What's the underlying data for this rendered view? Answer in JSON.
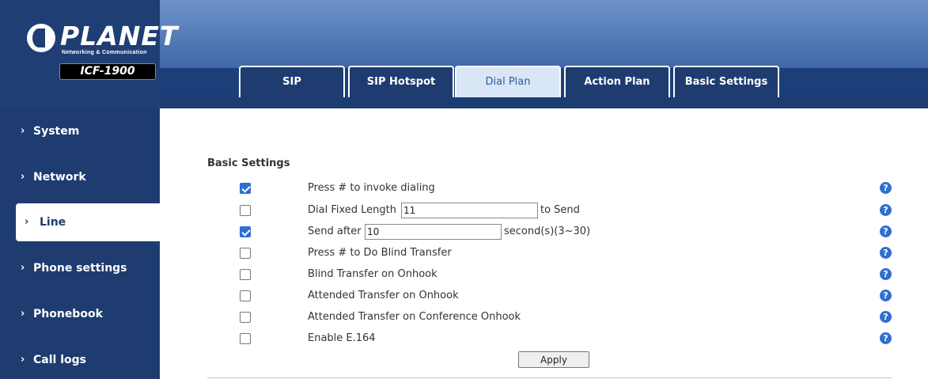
{
  "brand": {
    "logo_text": "PLANET",
    "logo_sub": "Networking & Communication",
    "model": "ICF-1900"
  },
  "tabs": [
    {
      "label": "SIP"
    },
    {
      "label": "SIP Hotspot"
    },
    {
      "label": "Dial Plan",
      "active": true
    },
    {
      "label": "Action Plan"
    },
    {
      "label": "Basic Settings"
    }
  ],
  "sidebar": {
    "items": [
      {
        "label": "System"
      },
      {
        "label": "Network"
      },
      {
        "label": "Line",
        "active": true
      },
      {
        "label": "Phone settings"
      },
      {
        "label": "Phonebook"
      },
      {
        "label": "Call logs"
      }
    ],
    "chevron": "›"
  },
  "section": {
    "title": "Basic Settings"
  },
  "settings": [
    {
      "label": "Press # to invoke dialing",
      "checked": true
    },
    {
      "label": "Dial Fixed Length",
      "checked": false,
      "value": "11",
      "suffix": "to Send"
    },
    {
      "label": "Send after",
      "checked": true,
      "value": "10",
      "suffix": "second(s)(3~30)"
    },
    {
      "label": "Press # to Do Blind Transfer",
      "checked": false
    },
    {
      "label": "Blind Transfer on Onhook",
      "checked": false
    },
    {
      "label": "Attended Transfer on Onhook",
      "checked": false
    },
    {
      "label": "Attended Transfer on Conference Onhook",
      "checked": false
    },
    {
      "label": "Enable E.164",
      "checked": false
    }
  ],
  "help_glyph": "?",
  "apply_label": "Apply",
  "colors": {
    "header": "#1e3c70",
    "accent": "#2f6fd1",
    "active_tab": "#d8e6f6"
  }
}
